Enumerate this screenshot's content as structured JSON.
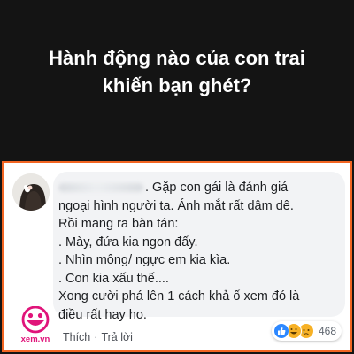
{
  "headline": {
    "line1": "Hành động nào của con trai",
    "line2": "khiến bạn ghét?"
  },
  "comment": {
    "lines": [
      ". Gặp con gái là đánh giá",
      "ngoại hình người ta. Ánh mắt rất dâm dê.",
      "Rồi mang ra bàn tán:",
      ". Mày, đứa kia ngon đấy.",
      ". Nhìn mông/ ngực em kia kìa.",
      ". Con kia xấu thế....",
      "Xong cười phá lên 1 cách khả ố xem đó là",
      "điều rất hay ho."
    ],
    "like_label": "Thích",
    "reply_label": "Trả lời",
    "separator": "·",
    "reaction_count": "468",
    "reactions": [
      "like-icon",
      "haha-icon",
      "sad-icon"
    ]
  },
  "watermark": {
    "text": "xem.vn",
    "color": "#e0147a"
  },
  "colors": {
    "frame_border": "#f26522",
    "background": "#141414",
    "like_blue": "#2d88ff"
  }
}
